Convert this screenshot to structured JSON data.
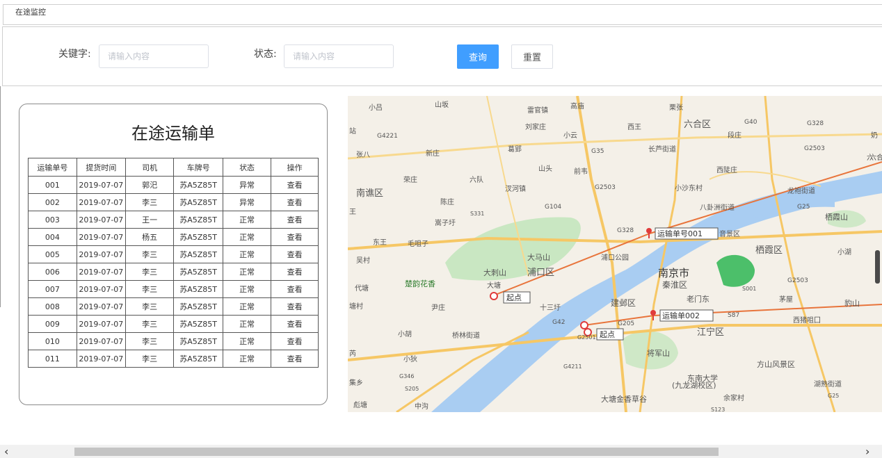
{
  "breadcrumb": {
    "title": "在途监控"
  },
  "filters": {
    "keyword_label": "关键字:",
    "keyword_placeholder": "请输入内容",
    "status_label": "状态:",
    "status_placeholder": "请输入内容",
    "query_label": "查询",
    "reset_label": "重置"
  },
  "orders": {
    "title": "在途运输单",
    "columns": [
      "运输单号",
      "提货时间",
      "司机",
      "车牌号",
      "状态",
      "操作"
    ],
    "rows": [
      {
        "id": "001",
        "time": "2019-07-07",
        "driver": "郭汜",
        "plate": "苏A5Z85T",
        "status": "异常",
        "action": "查看"
      },
      {
        "id": "002",
        "time": "2019-07-07",
        "driver": "李三",
        "plate": "苏A5Z85T",
        "status": "异常",
        "action": "查看"
      },
      {
        "id": "003",
        "time": "2019-07-07",
        "driver": "王一",
        "plate": "苏A5Z85T",
        "status": "正常",
        "action": "查看"
      },
      {
        "id": "004",
        "time": "2019-07-07",
        "driver": "杨五",
        "plate": "苏A5Z85T",
        "status": "正常",
        "action": "查看"
      },
      {
        "id": "005",
        "time": "2019-07-07",
        "driver": "李三",
        "plate": "苏A5Z85T",
        "status": "正常",
        "action": "查看"
      },
      {
        "id": "006",
        "time": "2019-07-07",
        "driver": "李三",
        "plate": "苏A5Z85T",
        "status": "正常",
        "action": "查看"
      },
      {
        "id": "007",
        "time": "2019-07-07",
        "driver": "李三",
        "plate": "苏A5Z85T",
        "status": "正常",
        "action": "查看"
      },
      {
        "id": "008",
        "time": "2019-07-07",
        "driver": "李三",
        "plate": "苏A5Z85T",
        "status": "正常",
        "action": "查看"
      },
      {
        "id": "009",
        "time": "2019-07-07",
        "driver": "李三",
        "plate": "苏A5Z85T",
        "status": "正常",
        "action": "查看"
      },
      {
        "id": "010",
        "time": "2019-07-07",
        "driver": "李三",
        "plate": "苏A5Z85T",
        "status": "正常",
        "action": "查看"
      },
      {
        "id": "011",
        "time": "2019-07-07",
        "driver": "李三",
        "plate": "苏A5Z85T",
        "status": "正常",
        "action": "查看"
      }
    ]
  },
  "map": {
    "route1_label": "运输单号001",
    "route2_label": "运输单002",
    "start_label_1": "起点",
    "start_label_2": "起点",
    "places": [
      "小吕",
      "山坂",
      "雷官镇",
      "高庙",
      "栗张",
      "六合区",
      "G40",
      "G328",
      "奶",
      "刘家庄",
      "西王",
      "段庄",
      "六合",
      "站",
      "G4221",
      "小云",
      "张八",
      "新庄",
      "葛郢",
      "G35",
      "长芦街道",
      "G2503",
      "山头",
      "前韦",
      "西陡庄",
      "六",
      "荣庄",
      "六队",
      "南谯区",
      "汊河镇",
      "G2503",
      "小沙东村",
      "龙袍街道",
      "陈庄",
      "G104",
      "八卦洲街道",
      "G25",
      "栖霞山",
      "王",
      "S331",
      "嵩子圩",
      "G328",
      "运输单号001",
      "音景区",
      "东王",
      "毛咀子",
      "浦口公园",
      "栖霞区",
      "小湖",
      "吴村",
      "大马山",
      "大刺山",
      "浦口区",
      "南京市",
      "秦淮区",
      "G2503",
      "楚韵花香",
      "大塘",
      "代塘",
      "S001",
      "起点",
      "老门东",
      "茅屋",
      "豹山",
      "建邺区",
      "十三圩",
      "尹庄",
      "运输单002",
      "S87",
      "塘村",
      "G42",
      "G205",
      "西猪咀囗",
      "小胡",
      "桥林街道",
      "江宁区",
      "起点",
      "G2501",
      "芮",
      "小狄",
      "将军山",
      "方山风景区",
      "G4211",
      "东南大学",
      "(九龙湖校区)",
      "G346",
      "湖熟街道",
      "集乡",
      "S205",
      "G25",
      "大塘金香草谷",
      "彪塘",
      "余家村",
      "中沟",
      "S123"
    ]
  },
  "colors": {
    "accent": "#409eff",
    "abnormal": "#c0392b",
    "route": "#e8743b"
  },
  "icons": {
    "scroll_left": "chevron-left-icon",
    "scroll_right": "chevron-right-icon"
  }
}
